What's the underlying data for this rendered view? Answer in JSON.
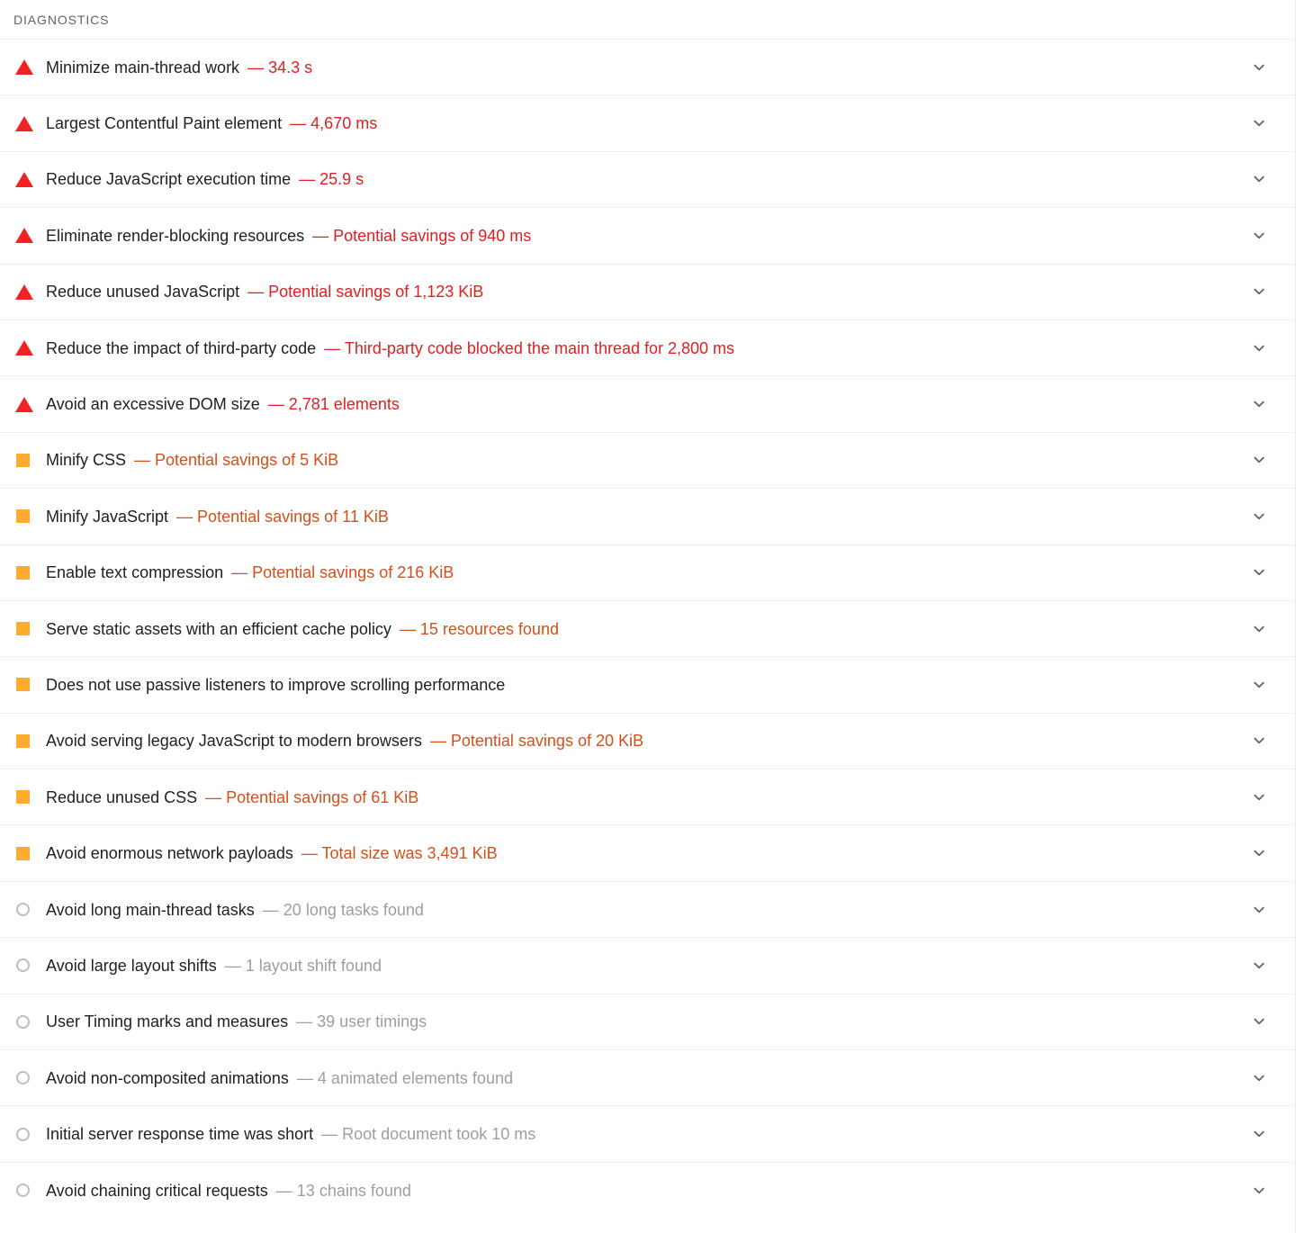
{
  "section": {
    "header": "DIAGNOSTICS"
  },
  "colors": {
    "error": "#e02020",
    "error_icon": "#f32222",
    "warn": "#d2501c",
    "warn_icon": "#ffab30",
    "info": "#9e9e9e",
    "info_icon": "#bdbdbd",
    "title": "#212121",
    "header": "#5f6368",
    "divider": "#f0f0f0"
  },
  "icons": {
    "error": "warning-triangle-icon",
    "warn": "warning-square-icon",
    "info": "info-circle-icon",
    "expand": "chevron-down-icon"
  },
  "audits": [
    {
      "title": "Minimize main-thread work",
      "value": "— 34.3 s",
      "severity": "error"
    },
    {
      "title": "Largest Contentful Paint element",
      "value": "— 4,670 ms",
      "severity": "error"
    },
    {
      "title": "Reduce JavaScript execution time",
      "value": "— 25.9 s",
      "severity": "error"
    },
    {
      "title": "Eliminate render-blocking resources",
      "value": "— Potential savings of 940 ms",
      "severity": "error"
    },
    {
      "title": "Reduce unused JavaScript",
      "value": "— Potential savings of 1,123 KiB",
      "severity": "error"
    },
    {
      "title": "Reduce the impact of third-party code",
      "value": "— Third-party code blocked the main thread for 2,800 ms",
      "severity": "error"
    },
    {
      "title": "Avoid an excessive DOM size",
      "value": "— 2,781 elements",
      "severity": "error"
    },
    {
      "title": "Minify CSS",
      "value": "— Potential savings of 5 KiB",
      "severity": "warn"
    },
    {
      "title": "Minify JavaScript",
      "value": "— Potential savings of 11 KiB",
      "severity": "warn"
    },
    {
      "title": "Enable text compression",
      "value": "— Potential savings of 216 KiB",
      "severity": "warn"
    },
    {
      "title": "Serve static assets with an efficient cache policy",
      "value": "— 15 resources found",
      "severity": "warn"
    },
    {
      "title": "Does not use passive listeners to improve scrolling performance",
      "value": "",
      "severity": "warn"
    },
    {
      "title": "Avoid serving legacy JavaScript to modern browsers",
      "value": "— Potential savings of 20 KiB",
      "severity": "warn"
    },
    {
      "title": "Reduce unused CSS",
      "value": "— Potential savings of 61 KiB",
      "severity": "warn"
    },
    {
      "title": "Avoid enormous network payloads",
      "value": "— Total size was 3,491 KiB",
      "severity": "warn"
    },
    {
      "title": "Avoid long main-thread tasks",
      "value": "— 20 long tasks found",
      "severity": "info"
    },
    {
      "title": "Avoid large layout shifts",
      "value": "— 1 layout shift found",
      "severity": "info"
    },
    {
      "title": "User Timing marks and measures",
      "value": "— 39 user timings",
      "severity": "info"
    },
    {
      "title": "Avoid non-composited animations",
      "value": "— 4 animated elements found",
      "severity": "info"
    },
    {
      "title": "Initial server response time was short",
      "value": "— Root document took 10 ms",
      "severity": "info"
    },
    {
      "title": "Avoid chaining critical requests",
      "value": "— 13 chains found",
      "severity": "info"
    }
  ]
}
